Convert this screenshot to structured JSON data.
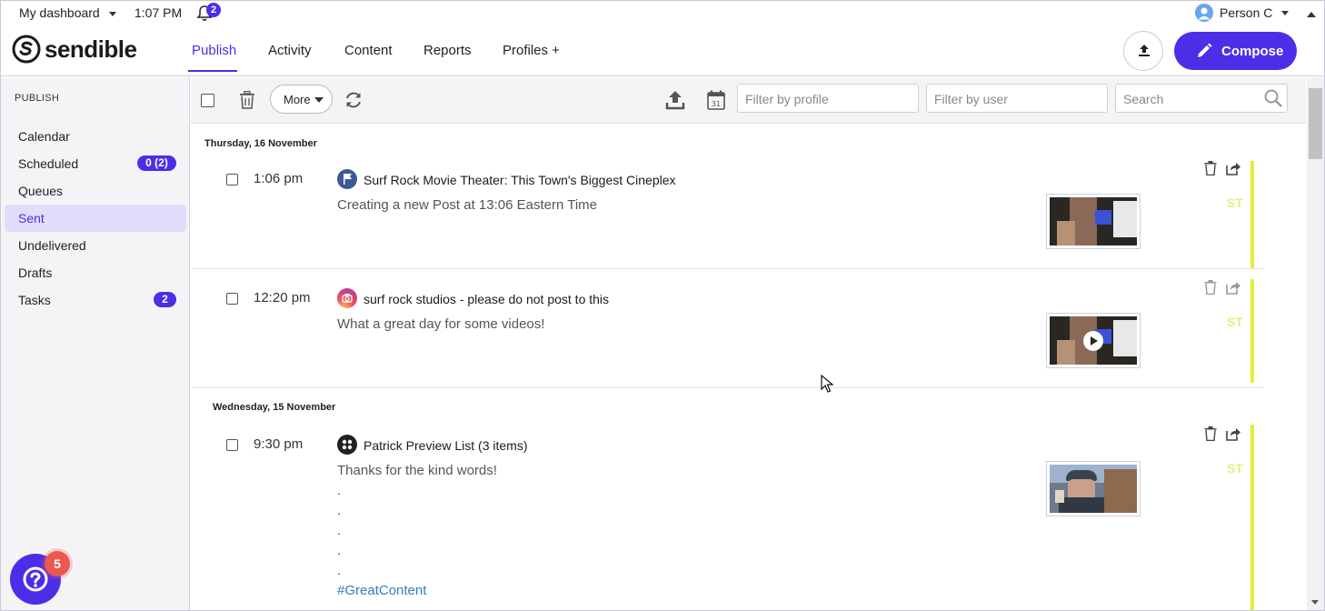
{
  "topbar": {
    "dashboard_label": "My dashboard",
    "time": "1:07 PM",
    "notifications_count": "2",
    "user_name": "Person C"
  },
  "brand": {
    "name": "sendible"
  },
  "nav": {
    "tabs": [
      {
        "label": "Publish",
        "active": true
      },
      {
        "label": "Activity"
      },
      {
        "label": "Content"
      },
      {
        "label": "Reports"
      },
      {
        "label": "Profiles +"
      }
    ],
    "compose_label": "Compose"
  },
  "sidebar": {
    "heading": "PUBLISH",
    "items": [
      {
        "label": "Calendar"
      },
      {
        "label": "Scheduled",
        "badge": "0 (2)"
      },
      {
        "label": "Queues"
      },
      {
        "label": "Sent",
        "active": true
      },
      {
        "label": "Undelivered"
      },
      {
        "label": "Drafts"
      },
      {
        "label": "Tasks",
        "badge": "2"
      }
    ],
    "help_badge": "5"
  },
  "toolbar": {
    "more_label": "More",
    "filter_profile_placeholder": "Filter by profile",
    "filter_user_placeholder": "Filter by user",
    "search_placeholder": "Search"
  },
  "feed": {
    "days": [
      {
        "label": "Thursday, 16 November",
        "posts": [
          {
            "time": "1:06 pm",
            "network": "flag",
            "title": "Surf Rock Movie Theater: This Town's Biggest Cineplex",
            "text": "Creating a new Post at 13:06 Eastern Time",
            "status": "ST"
          },
          {
            "time": "12:20 pm",
            "network": "instagram",
            "title": "surf rock studios - please do not post to this",
            "text": "What a great day for some videos!",
            "status": "ST"
          }
        ]
      },
      {
        "label": "Wednesday, 15 November",
        "posts": [
          {
            "time": "9:30 pm",
            "network": "list",
            "title": "Patrick Preview List (3 items)",
            "text": "Thanks for the kind words!",
            "dots": [
              ".",
              ".",
              ".",
              ".",
              "."
            ],
            "hashtag": "#GreatContent",
            "status": "ST"
          }
        ]
      }
    ]
  },
  "colors": {
    "accent": "#4c2ee8",
    "status_bar": "#e2ee3a",
    "badge_red": "#ea5a51"
  }
}
